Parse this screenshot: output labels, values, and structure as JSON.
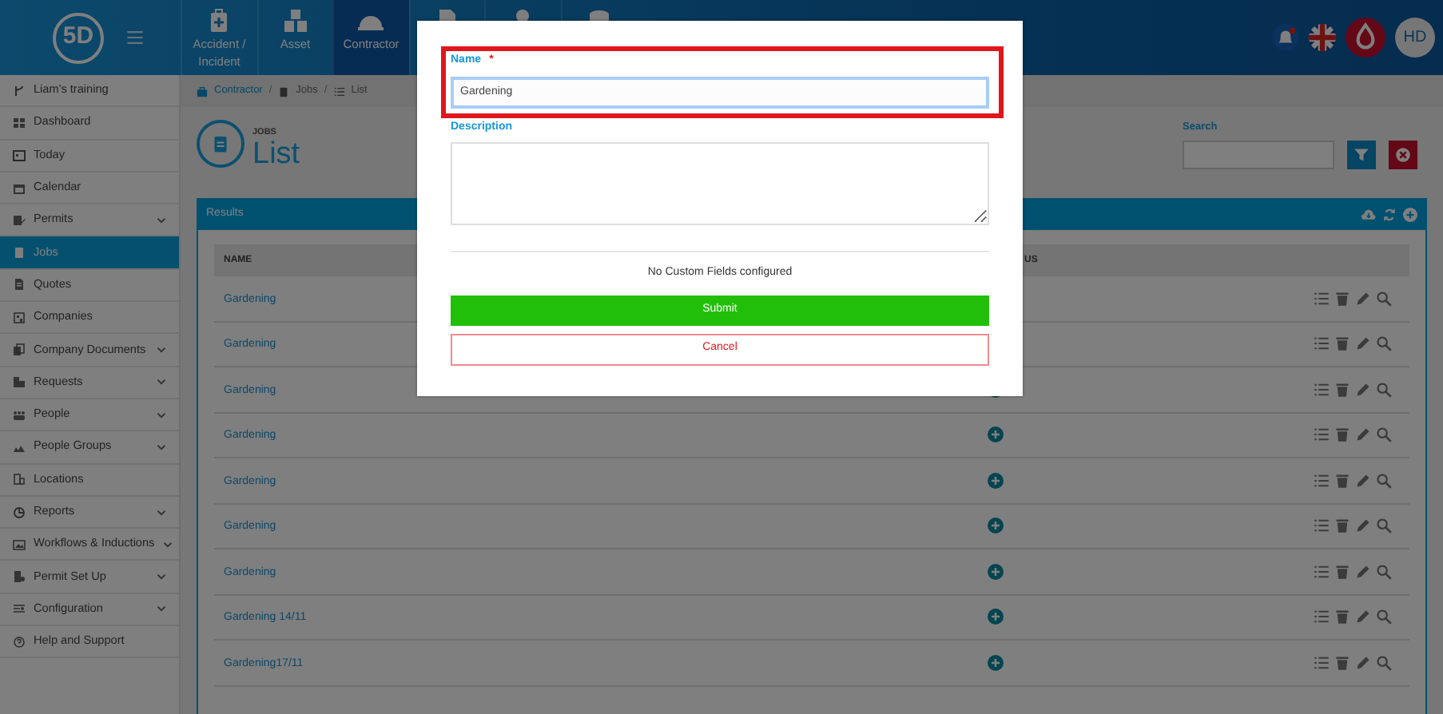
{
  "topbar": {
    "logo": "5D",
    "nav_tiles": [
      {
        "label": "Accident / Incident",
        "selected": false
      },
      {
        "label": "Asset",
        "selected": false
      },
      {
        "label": "Contractor",
        "selected": true
      },
      {
        "selected": false
      },
      {
        "selected": false
      },
      {
        "selected": false
      }
    ],
    "avatar": "HD"
  },
  "sidebar": {
    "items": [
      {
        "label": "Liam's training",
        "expandable": false,
        "selected": false
      },
      {
        "label": "Dashboard",
        "expandable": false,
        "selected": false
      },
      {
        "label": "Today",
        "expandable": false,
        "selected": false
      },
      {
        "label": "Calendar",
        "expandable": false,
        "selected": false
      },
      {
        "label": "Permits",
        "expandable": true,
        "selected": false
      },
      {
        "label": "Jobs",
        "expandable": false,
        "selected": true
      },
      {
        "label": "Quotes",
        "expandable": false,
        "selected": false
      },
      {
        "label": "Companies",
        "expandable": false,
        "selected": false
      },
      {
        "label": "Company Documents",
        "expandable": true,
        "selected": false
      },
      {
        "label": "Requests",
        "expandable": true,
        "selected": false
      },
      {
        "label": "People",
        "expandable": true,
        "selected": false
      },
      {
        "label": "People Groups",
        "expandable": true,
        "selected": false
      },
      {
        "label": "Locations",
        "expandable": false,
        "selected": false
      },
      {
        "label": "Reports",
        "expandable": true,
        "selected": false
      },
      {
        "label": "Workflows & Inductions",
        "expandable": true,
        "selected": false
      },
      {
        "label": "Permit Set Up",
        "expandable": true,
        "selected": false
      },
      {
        "label": "Configuration",
        "expandable": true,
        "selected": false
      },
      {
        "label": "Help and Support",
        "expandable": false,
        "selected": false
      }
    ]
  },
  "breadcrumb": [
    "Contractor",
    "Jobs",
    "List"
  ],
  "breadcrumb_separator": "/",
  "page": {
    "eyebrow": "JOBS",
    "title": "List"
  },
  "search": {
    "label": "Search"
  },
  "results": {
    "title": "Results",
    "columns": [
      "NAME",
      "US"
    ],
    "rows": [
      {
        "name": "Gardening"
      },
      {
        "name": "Gardening"
      },
      {
        "name": "Gardening"
      },
      {
        "name": "Gardening"
      },
      {
        "name": "Gardening"
      },
      {
        "name": "Gardening"
      },
      {
        "name": "Gardening"
      },
      {
        "name": "Gardening 14/11"
      },
      {
        "name": "Gardening17/11"
      }
    ]
  },
  "modal": {
    "name_label": "Name",
    "required_mark": "*",
    "name_value": "Gardening",
    "highlighted": true,
    "description_label": "Description",
    "note": "No Custom Fields configured",
    "submit": "Submit",
    "cancel": "Cancel"
  }
}
